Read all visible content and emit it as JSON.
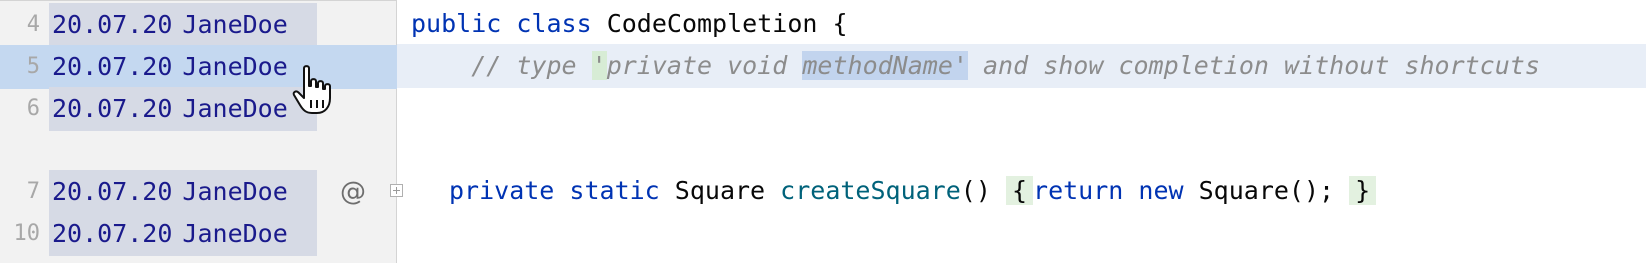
{
  "gutter": {
    "rows": [
      {
        "line": "4",
        "date": "20.07.20",
        "author": "JaneDoe"
      },
      {
        "line": "5",
        "date": "20.07.20",
        "author": "JaneDoe"
      },
      {
        "line": "6",
        "date": "20.07.20",
        "author": "JaneDoe"
      },
      {
        "line": "7",
        "date": "20.07.20",
        "author": "JaneDoe"
      },
      {
        "line": "10",
        "date": "20.07.20",
        "author": "JaneDoe"
      }
    ],
    "at_symbol": "@"
  },
  "code": {
    "line1": {
      "kw1": "public",
      "kw2": "class",
      "name": "CodeCompletion",
      "brace": "{"
    },
    "line2": {
      "prefix": "    // type ",
      "quote_open": "'",
      "mid": "private void ",
      "method": "methodName'",
      "suffix": " and show completion without shortcuts"
    },
    "line4": {
      "kw1": "private",
      "kw2": "static",
      "type": "Square",
      "method": "createSquare",
      "parens": "()",
      "open_brace": "{",
      "kw3": "return",
      "kw4": "new",
      "ctor": "Square();",
      "close_brace": "}"
    }
  },
  "colors": {
    "keyword": "#0033b3",
    "function": "#00627a",
    "comment": "#8c8c8c",
    "annotation_text": "#1a1a8c",
    "selection": "#c4d8f0"
  }
}
